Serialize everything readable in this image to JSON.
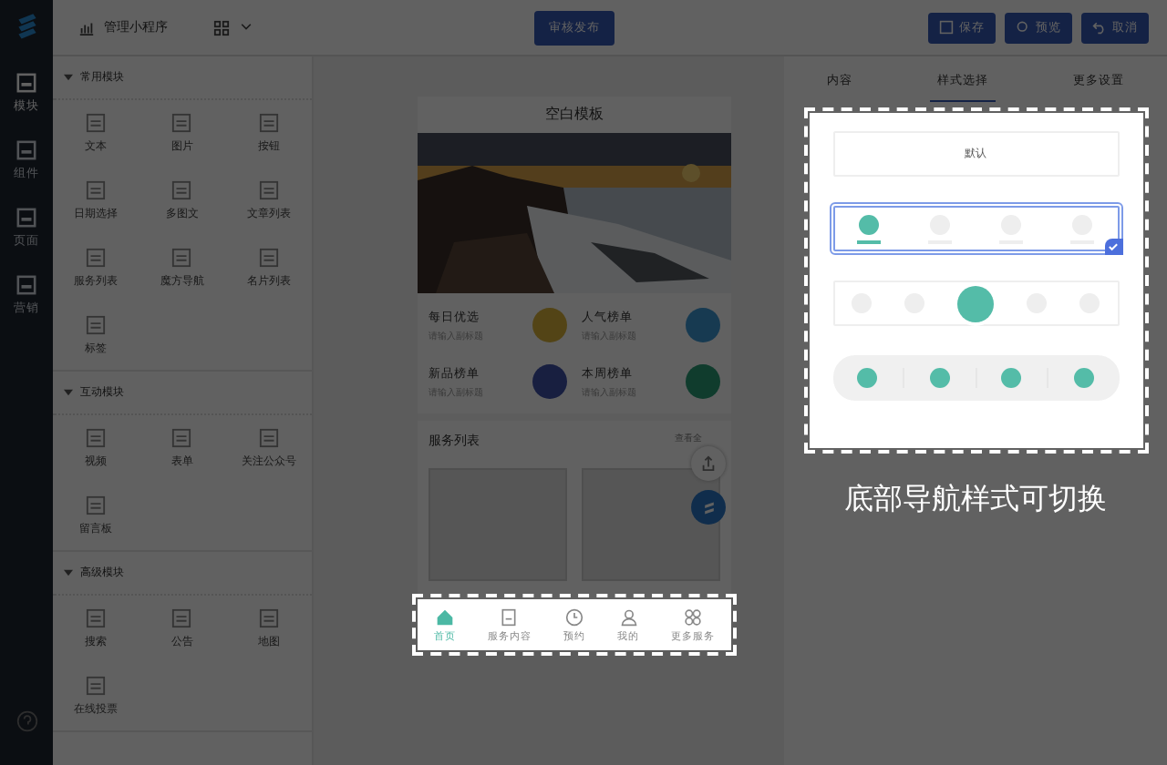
{
  "rail": {
    "items": [
      {
        "label": "模块",
        "selected": true
      },
      {
        "label": "组件",
        "selected": false
      },
      {
        "label": "页面",
        "selected": false
      },
      {
        "label": "营销",
        "selected": false
      }
    ]
  },
  "topbar": {
    "app_title": "管理小程序",
    "publish_button": "审核发布",
    "actions": [
      {
        "label": "保存",
        "kind": "save"
      },
      {
        "label": "预览",
        "kind": "preview"
      },
      {
        "label": "取消",
        "kind": "undo"
      }
    ]
  },
  "module_groups": [
    {
      "title": "常用模块",
      "expanded": true,
      "items": [
        "文本",
        "图片",
        "按钮",
        "日期选择",
        "多图文",
        "文章列表",
        "服务列表",
        "魔方导航",
        "名片列表",
        "标签"
      ]
    },
    {
      "title": "互动模块",
      "expanded": true,
      "items": [
        "视频",
        "表单",
        "关注公众号",
        "留言板"
      ]
    },
    {
      "title": "高级模块",
      "expanded": true,
      "items": [
        "搜索",
        "公告",
        "地图",
        "在线投票"
      ]
    }
  ],
  "phone": {
    "title": "空白模板",
    "cards": [
      {
        "title": "每日优选",
        "subtitle": "请输入副标题",
        "kind": "bowl"
      },
      {
        "title": "人气榜单",
        "subtitle": "请输入副标题",
        "kind": "cutlery"
      },
      {
        "title": "新品榜单",
        "subtitle": "请输入副标题",
        "kind": "cake"
      },
      {
        "title": "本周榜单",
        "subtitle": "请输入副标题",
        "kind": "megaphone"
      }
    ],
    "section_title": "服务列表",
    "section_link": "查看全",
    "nav": [
      {
        "label": "首页",
        "selected": true,
        "kind": "home"
      },
      {
        "label": "服务内容",
        "selected": false,
        "kind": "doc"
      },
      {
        "label": "预约",
        "selected": false,
        "kind": "clock"
      },
      {
        "label": "我的",
        "selected": false,
        "kind": "person"
      },
      {
        "label": "更多服务",
        "selected": false,
        "kind": "grid"
      }
    ]
  },
  "right_tabs": [
    {
      "label": "内容",
      "selected": false
    },
    {
      "label": "样式选择",
      "selected": true
    },
    {
      "label": "更多设置",
      "selected": false
    }
  ],
  "styles": [
    {
      "kind": "text",
      "label": "默认",
      "selected": false
    },
    {
      "kind": "underline",
      "selected": true
    },
    {
      "kind": "center",
      "selected": false
    },
    {
      "kind": "pill",
      "selected": false
    }
  ],
  "caption": "底部导航样式可切换"
}
